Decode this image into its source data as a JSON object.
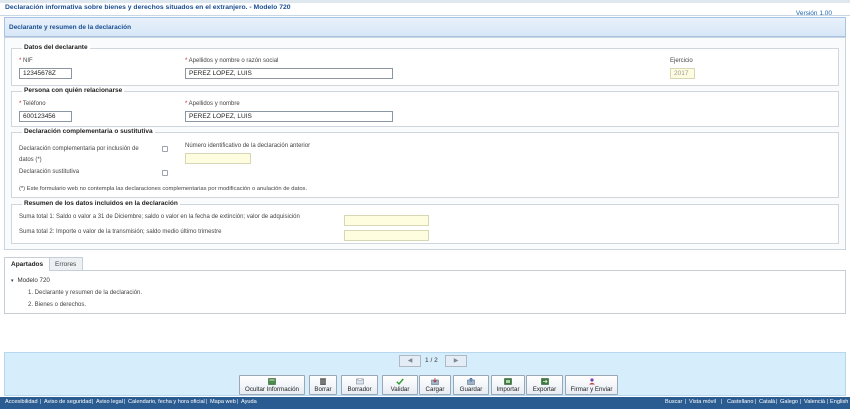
{
  "app": {
    "title": "Declaración informativa sobre bienes y derechos situados en el extranjero. - Modelo 720",
    "version": "Versión 1.00"
  },
  "section": {
    "title": "Declarante y resumen de la declaración"
  },
  "declarante": {
    "legend": "Datos del declarante",
    "nif_label": "NIF",
    "nif_value": "12345678Z",
    "name_label": "Apellidos y nombre o razón social",
    "name_value": "PEREZ LOPEZ, LUIS",
    "ejercicio_label": "Ejercicio",
    "ejercicio_value": "2017"
  },
  "contacto": {
    "legend": "Persona con quién relacionarse",
    "telefono_label": "Teléfono",
    "telefono_value": "600123456",
    "name_label": "Apellidos y nombre",
    "name_value": "PEREZ LOPEZ, LUIS"
  },
  "complementaria": {
    "legend": "Declaración complementaria o sustitutiva",
    "comp_label_line1": "Declaración complementaria por inclusión de",
    "comp_label_line2": "datos (*)",
    "sust_label": "Declaración sustitutiva",
    "numero_label": "Número identificativo de la declaración anterior",
    "numero_value": "",
    "note": "(*) Este formulario web no contempla las declaraciones complementarias por modificación o anulación de datos."
  },
  "resumen": {
    "legend": "Resumen de los datos incluidos en la declaración",
    "suma1_label": "Suma total 1: Saldo o valor a 31 de Diciembre; saldo o valor en la fecha de extinción; valor de adquisición",
    "suma1_value": "",
    "suma2_label": "Suma total 2: Importe o valor de la transmisión; saldo medio último trimestre",
    "suma2_value": ""
  },
  "tabs": [
    {
      "label": "Apartados",
      "active": true
    },
    {
      "label": "Errores",
      "active": false
    }
  ],
  "tree": {
    "root": "Modelo 720",
    "items": [
      "1. Declarante y resumen de la declaración.",
      "2. Bienes o derechos."
    ]
  },
  "pager": {
    "prev": "◀",
    "current": "1",
    "separator": "/",
    "total": "2",
    "next": "▶"
  },
  "toolbar": [
    {
      "label": "Ocultar Información",
      "icon": "hide-info-icon"
    },
    {
      "label": "Borrar",
      "icon": "trash-icon"
    },
    {
      "label": "Borrador",
      "icon": "draft-icon"
    },
    {
      "label": "Validar",
      "icon": "check-icon"
    },
    {
      "label": "Cargar",
      "icon": "load-icon"
    },
    {
      "label": "Guardar",
      "icon": "save-icon"
    },
    {
      "label": "Importar",
      "icon": "import-icon"
    },
    {
      "label": "Exportar",
      "icon": "export-icon"
    },
    {
      "label": "Firmar y Enviar",
      "icon": "sign-send-icon"
    }
  ],
  "footer": {
    "left": [
      "Accesibilidad",
      "Aviso de seguridad",
      "Aviso legal",
      "Calendario, fecha y hora oficial",
      "Mapa web",
      "Ayuda"
    ],
    "right": [
      "Buscar",
      "Vista móvil",
      "Castellano",
      "Català",
      "Galego",
      "Valencià",
      "English"
    ],
    "separator": "|"
  },
  "colors": {
    "brand": "#1b4f92",
    "footer": "#2a5c92",
    "required": "#d21b1b",
    "input_highlight": "#fffde0"
  }
}
